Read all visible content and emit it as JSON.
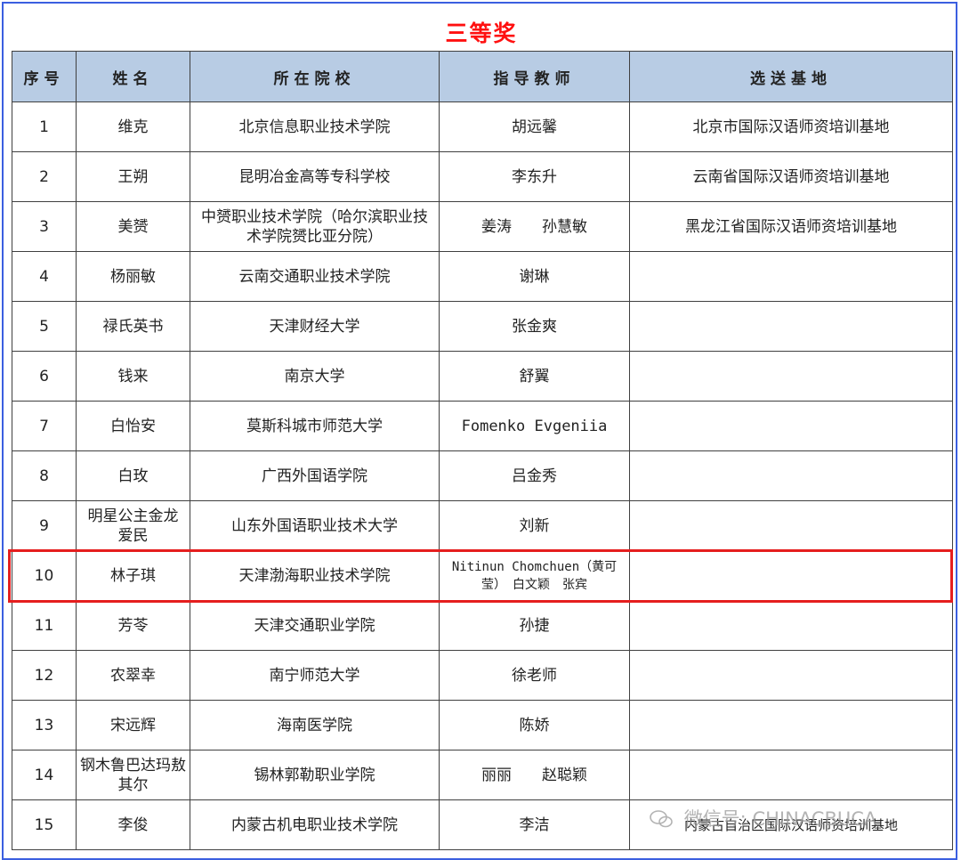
{
  "title": "三等奖",
  "headers": [
    "序号",
    "姓名",
    "所在院校",
    "指导教师",
    "选送基地"
  ],
  "rows": [
    {
      "no": "1",
      "name": "维克",
      "school": "北京信息职业技术学院",
      "teacher": "胡远馨",
      "base": "北京市国际汉语师资培训基地"
    },
    {
      "no": "2",
      "name": "王朔",
      "school": "昆明冶金高等专科学校",
      "teacher": "李东升",
      "base": "云南省国际汉语师资培训基地"
    },
    {
      "no": "3",
      "name": "美赟",
      "school": "中赟职业技术学院（哈尔滨职业技术学院赟比亚分院）",
      "teacher": "姜涛　　孙慧敏",
      "base": "黑龙江省国际汉语师资培训基地"
    },
    {
      "no": "4",
      "name": "杨丽敏",
      "school": "云南交通职业技术学院",
      "teacher": "谢琳",
      "base": ""
    },
    {
      "no": "5",
      "name": "禄氏英书",
      "school": "天津财经大学",
      "teacher": "张金爽",
      "base": ""
    },
    {
      "no": "6",
      "name": "钱来",
      "school": "南京大学",
      "teacher": "舒翼",
      "base": ""
    },
    {
      "no": "7",
      "name": "白怡安",
      "school": "莫斯科城市师范大学",
      "teacher": "Fomenko Evgeniia",
      "base": ""
    },
    {
      "no": "8",
      "name": "白玫",
      "school": "广西外国语学院",
      "teacher": "吕金秀",
      "base": ""
    },
    {
      "no": "9",
      "name": "明星公主金龙　爱民",
      "school": "山东外国语职业技术大学",
      "teacher": "刘新",
      "base": ""
    },
    {
      "no": "10",
      "name": "林子琪",
      "school": "天津渤海职业技术学院",
      "teacher": "Nitinun Chomchuen（黄可莹）　白文颖　张宾",
      "base": ""
    },
    {
      "no": "11",
      "name": "芳苓",
      "school": "天津交通职业学院",
      "teacher": "孙捷",
      "base": ""
    },
    {
      "no": "12",
      "name": "农翠幸",
      "school": "南宁师范大学",
      "teacher": "徐老师",
      "base": ""
    },
    {
      "no": "13",
      "name": "宋远辉",
      "school": "海南医学院",
      "teacher": "陈娇",
      "base": ""
    },
    {
      "no": "14",
      "name": "钢木鲁巴达玛敖其尔",
      "school": "锡林郭勒职业学院",
      "teacher": "丽丽　　赵聪颖",
      "base": ""
    },
    {
      "no": "15",
      "name": "李俊",
      "school": "内蒙古机电职业技术学院",
      "teacher": "李洁",
      "base": "内蒙古自治区国际汉语师资培训基地"
    }
  ],
  "watermark": "微信号: CHINACBUCA",
  "accent_colors": {
    "title": "#ff1010",
    "header_bg": "#b8cce4",
    "highlight": "#e51e1e",
    "frame": "#3b5fe0"
  }
}
